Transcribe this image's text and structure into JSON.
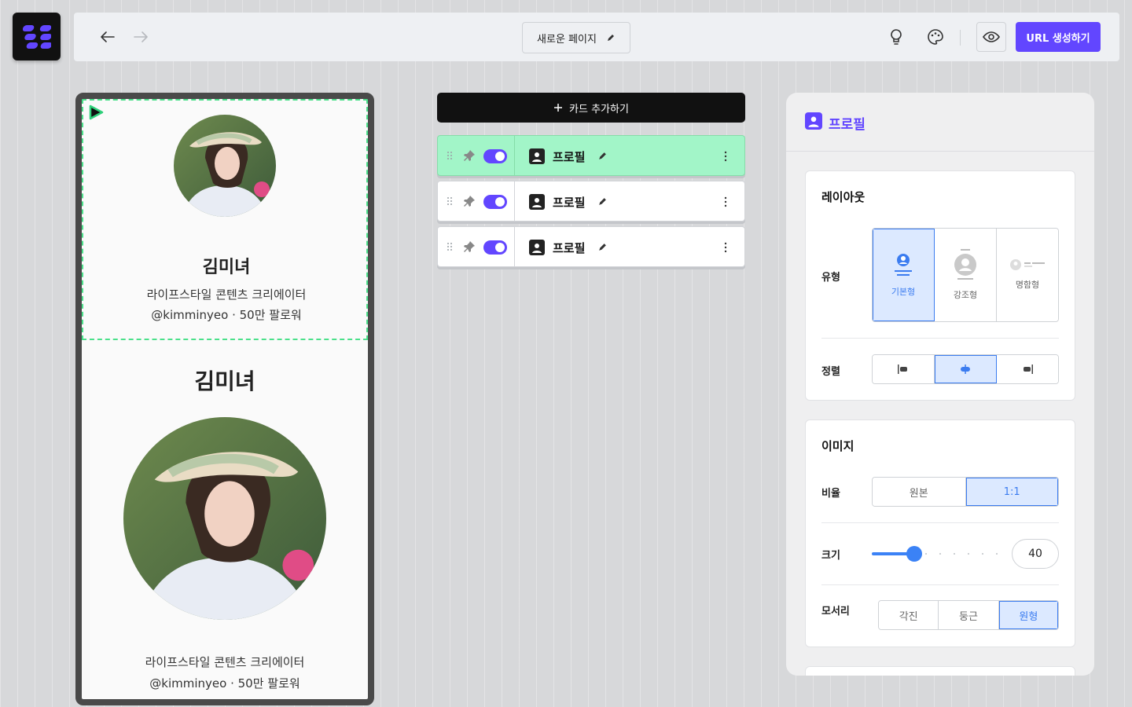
{
  "topbar": {
    "page_title": "새로운 페이지",
    "url_button": "URL 생성하기"
  },
  "preview": {
    "card1": {
      "name": "김미녀",
      "line1": "라이프스타일 콘텐츠 크리에이터",
      "line2": "@kimminyeo · 50만 팔로워"
    },
    "card2": {
      "name": "김미녀",
      "line1": "라이프스타일 콘텐츠 크리에이터",
      "line2": "@kimminyeo · 50만 팔로워"
    }
  },
  "cards": {
    "add_label": "카드 추가하기",
    "items": [
      {
        "label": "프로필",
        "active": true
      },
      {
        "label": "프로필",
        "active": false
      },
      {
        "label": "프로필",
        "active": false
      }
    ]
  },
  "panel": {
    "title": "프로필",
    "layout": {
      "title": "레이아웃",
      "type_label": "유형",
      "type_options": [
        "기본형",
        "강조형",
        "명함형"
      ],
      "type_selected": "기본형",
      "align_label": "정렬",
      "align_selected": "center"
    },
    "image": {
      "title": "이미지",
      "ratio_label": "비율",
      "ratio_options": [
        "원본",
        "1:1"
      ],
      "ratio_selected": "1:1",
      "size_label": "크기",
      "size_value": "40",
      "corner_label": "모서리",
      "corner_options": [
        "각진",
        "둥근",
        "원형"
      ],
      "corner_selected": "원형"
    }
  },
  "colors": {
    "accent": "#6246ff",
    "selected_blue": "#3b7cf0",
    "active_card": "#a2f5c8"
  }
}
